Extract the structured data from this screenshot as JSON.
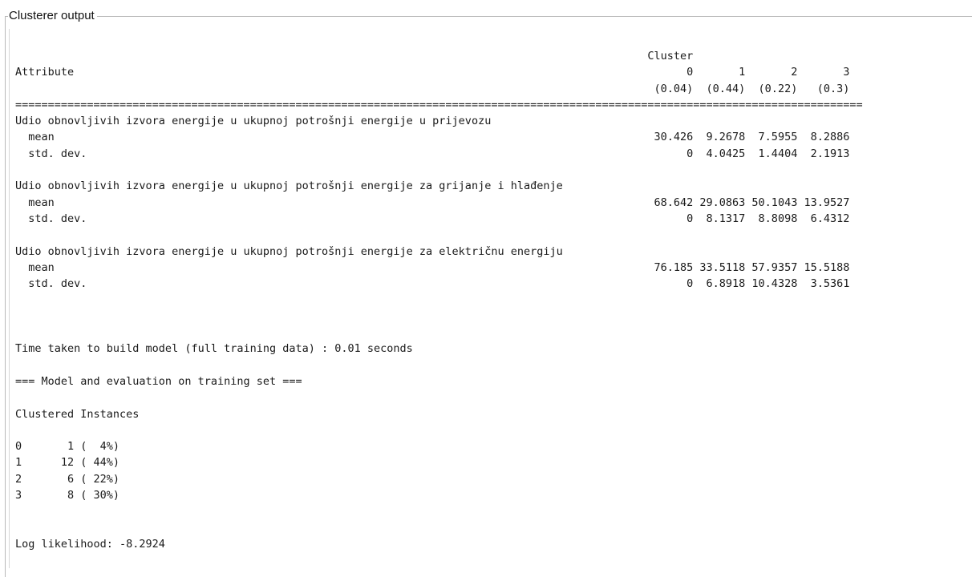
{
  "panel": {
    "title": "Clusterer output"
  },
  "output": {
    "text": "                                                                                                 Cluster\nAttribute                                                                                              0       1       2       3\n                                                                                                  (0.04)  (0.44)  (0.22)   (0.3)\n==================================================================================================================================\nUdio obnovljivih izvora energije u ukupnoj potrošnji energije u prijevozu\n  mean                                                                                            30.426  9.2678  7.5955  8.2886\n  std. dev.                                                                                            0  4.0425  1.4404  2.1913\n\nUdio obnovljivih izvora energije u ukupnoj potrošnji energije za grijanje i hlađenje\n  mean                                                                                            68.642 29.0863 50.1043 13.9527\n  std. dev.                                                                                            0  8.1317  8.8098  6.4312\n\nUdio obnovljivih izvora energije u ukupnoj potrošnji energije za električnu energiju\n  mean                                                                                            76.185 33.5118 57.9357 15.5188\n  std. dev.                                                                                            0  6.8918 10.4328  3.5361\n\n\n\nTime taken to build model (full training data) : 0.01 seconds\n\n=== Model and evaluation on training set ===\n\nClustered Instances\n\n0       1 (  4%)\n1      12 ( 44%)\n2       6 ( 22%)\n3       8 ( 30%)\n\n\nLog likelihood: -8.2924"
  }
}
